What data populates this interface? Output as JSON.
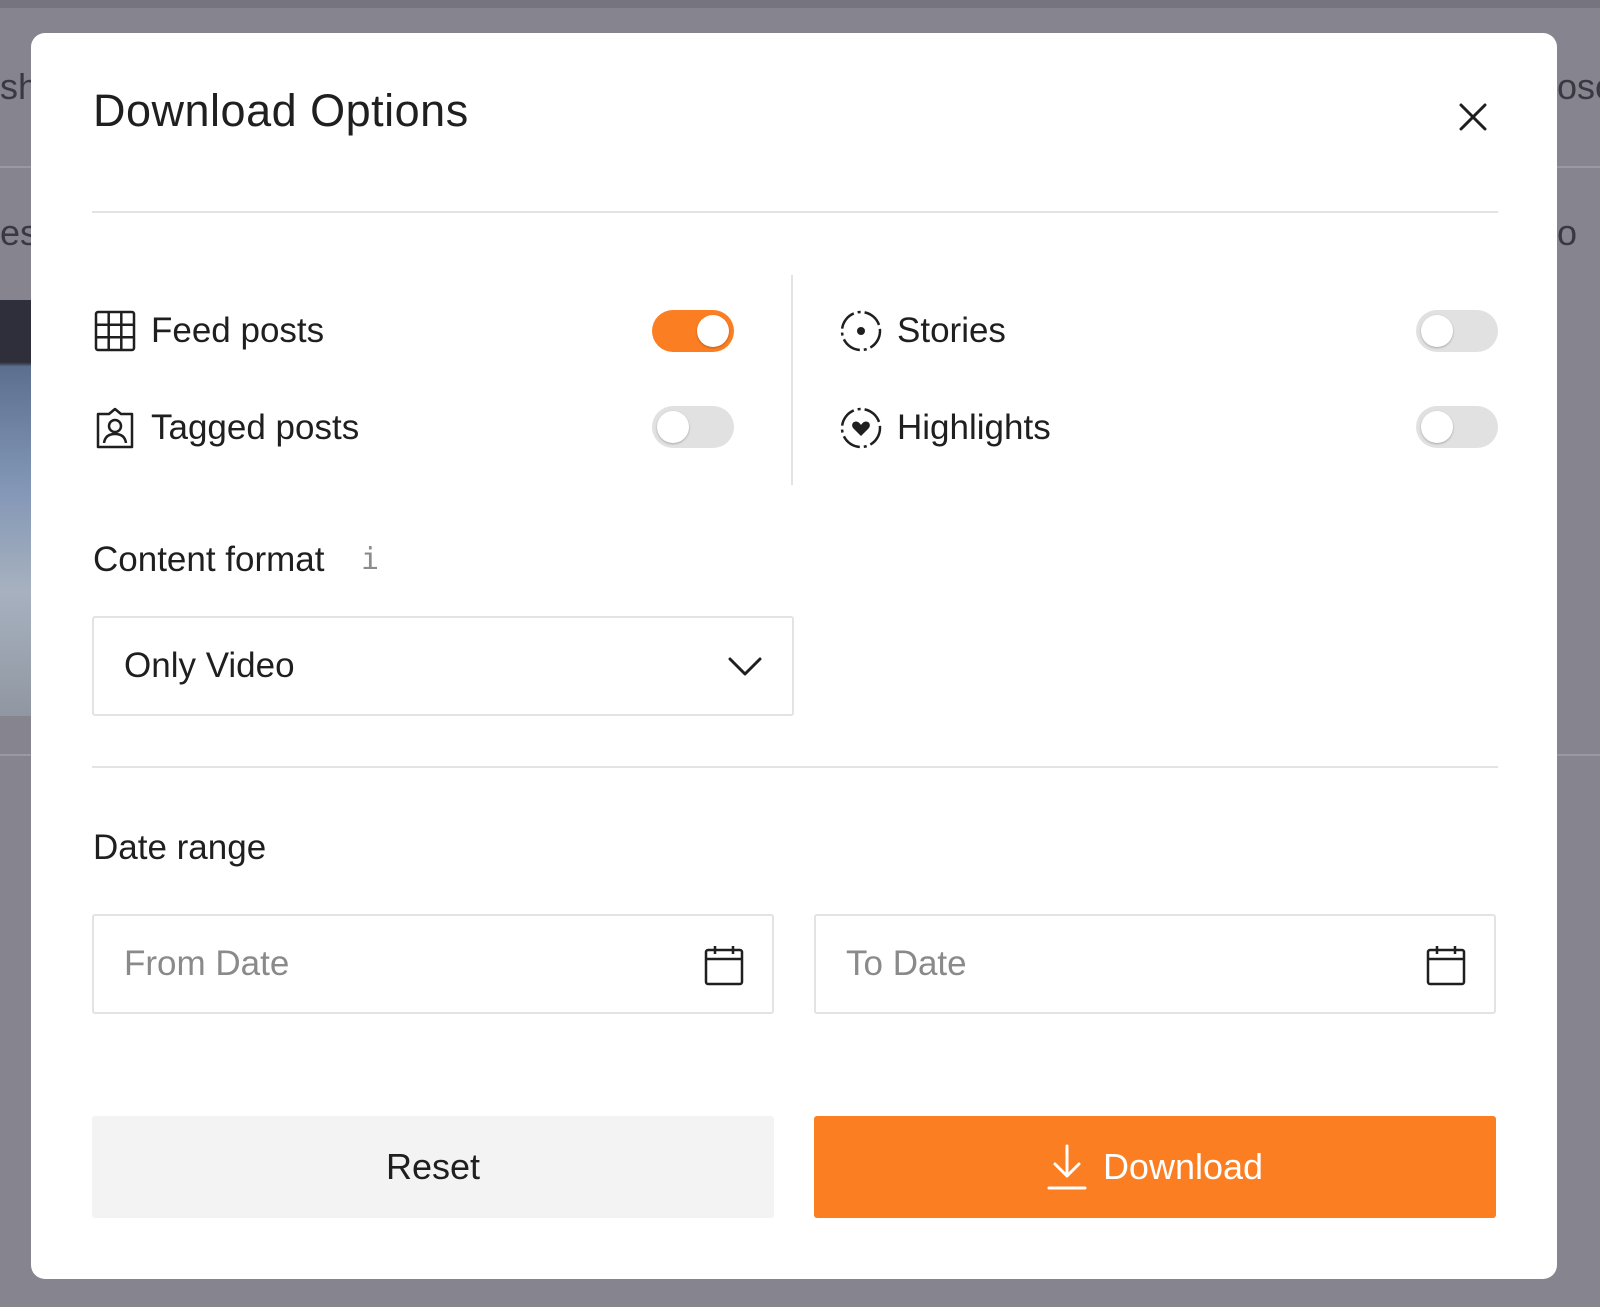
{
  "background": {
    "fragments": [
      "sh",
      "es",
      "osc",
      "o"
    ]
  },
  "modal": {
    "title": "Download Options",
    "close_icon": "close-icon"
  },
  "options": {
    "feed_posts": {
      "label": "Feed posts",
      "icon": "grid-icon",
      "enabled": true
    },
    "tagged_posts": {
      "label": "Tagged posts",
      "icon": "tagged-person-icon",
      "enabled": false
    },
    "stories": {
      "label": "Stories",
      "icon": "stories-icon",
      "enabled": false
    },
    "highlights": {
      "label": "Highlights",
      "icon": "highlights-heart-icon",
      "enabled": false
    }
  },
  "content_format": {
    "label": "Content format",
    "info_icon": "i",
    "selected": "Only Video"
  },
  "date_range": {
    "label": "Date range",
    "from_placeholder": "From Date",
    "to_placeholder": "To Date"
  },
  "actions": {
    "reset_label": "Reset",
    "download_label": "Download"
  },
  "colors": {
    "accent": "#fb7e23",
    "toggle_off": "#e1e1e1",
    "overlay": "#85848f"
  }
}
